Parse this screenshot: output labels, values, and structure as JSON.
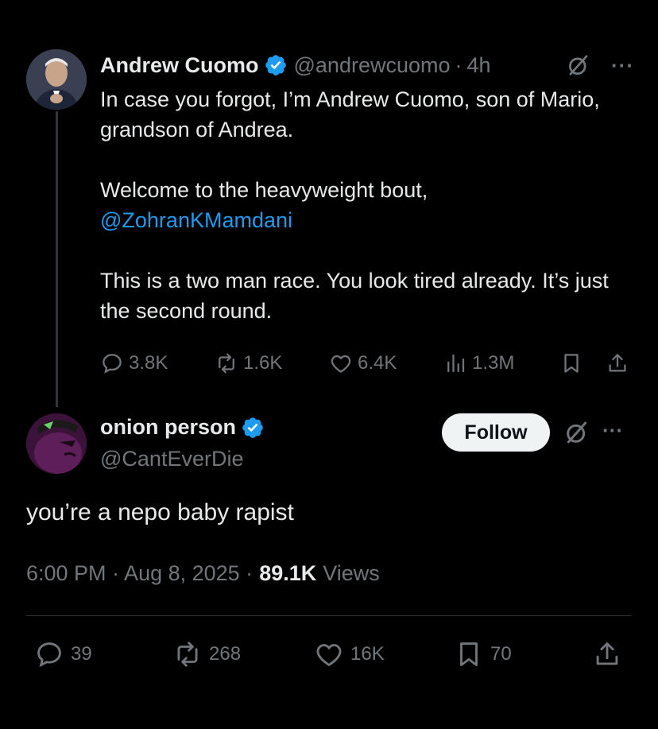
{
  "tweet1": {
    "name": "Andrew Cuomo",
    "handle": "@andrewcuomo",
    "separator": "·",
    "time": "4h",
    "more": "···",
    "paragraphs": [
      "In case you forgot, I’m Andrew Cuomo, son of Mario, grandson of Andrea.",
      "This is a two man race. You look tired already. It’s just the second round."
    ],
    "para2_text": "Welcome to the heavyweight bout,",
    "para2_mention": "@ZohranKMamdani",
    "actions": {
      "replies": "3.8K",
      "reposts": "1.6K",
      "likes": "6.4K",
      "views": "1.3M"
    }
  },
  "tweet2": {
    "name": "onion person",
    "handle": "@CantEverDie",
    "follow_label": "Follow",
    "more": "···",
    "text": "you’re a nepo baby rapist",
    "timestamp": "6:00 PM · Aug 8, 2025 ·",
    "views_count": "89.1K",
    "views_label": "Views",
    "actions": {
      "replies": "39",
      "reposts": "268",
      "likes": "16K",
      "bookmarks": "70"
    }
  },
  "colors": {
    "background": "#000000",
    "text": "#e7e9ea",
    "muted": "#71767b",
    "accent": "#1d9bf0",
    "follow_bg": "#eff3f4"
  },
  "icons": [
    "verified-badge-icon",
    "grok-icon",
    "more-icon",
    "reply-icon",
    "repost-icon",
    "like-icon",
    "views-icon",
    "bookmark-icon",
    "share-icon"
  ]
}
